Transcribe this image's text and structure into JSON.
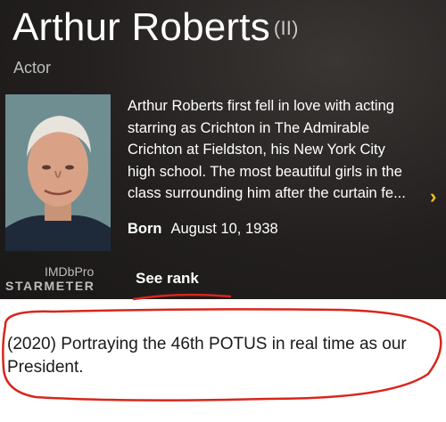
{
  "header": {
    "name": "Arthur Roberts",
    "name_suffix": "(II)",
    "role": "Actor"
  },
  "bio": {
    "lines": [
      "Arthur Roberts first fell in love with acting",
      "starring as Crichton in The Admirable",
      "Crichton at Fieldston, his New York City",
      "high school. The most beautiful girls in the",
      "class surrounding him after the curtain fe..."
    ],
    "expand_icon": "chevron-right-icon",
    "born_label": "Born",
    "born_date": "August 10, 1938"
  },
  "starmeter": {
    "imdbpro": "IMDbPro",
    "label": "STARMETER",
    "see_rank": "See rank"
  },
  "caption": {
    "text": "(2020) Portraying the 46th POTUS in real time as our President."
  },
  "colors": {
    "accent": "#f5c518",
    "annotation": "#d8261c"
  }
}
